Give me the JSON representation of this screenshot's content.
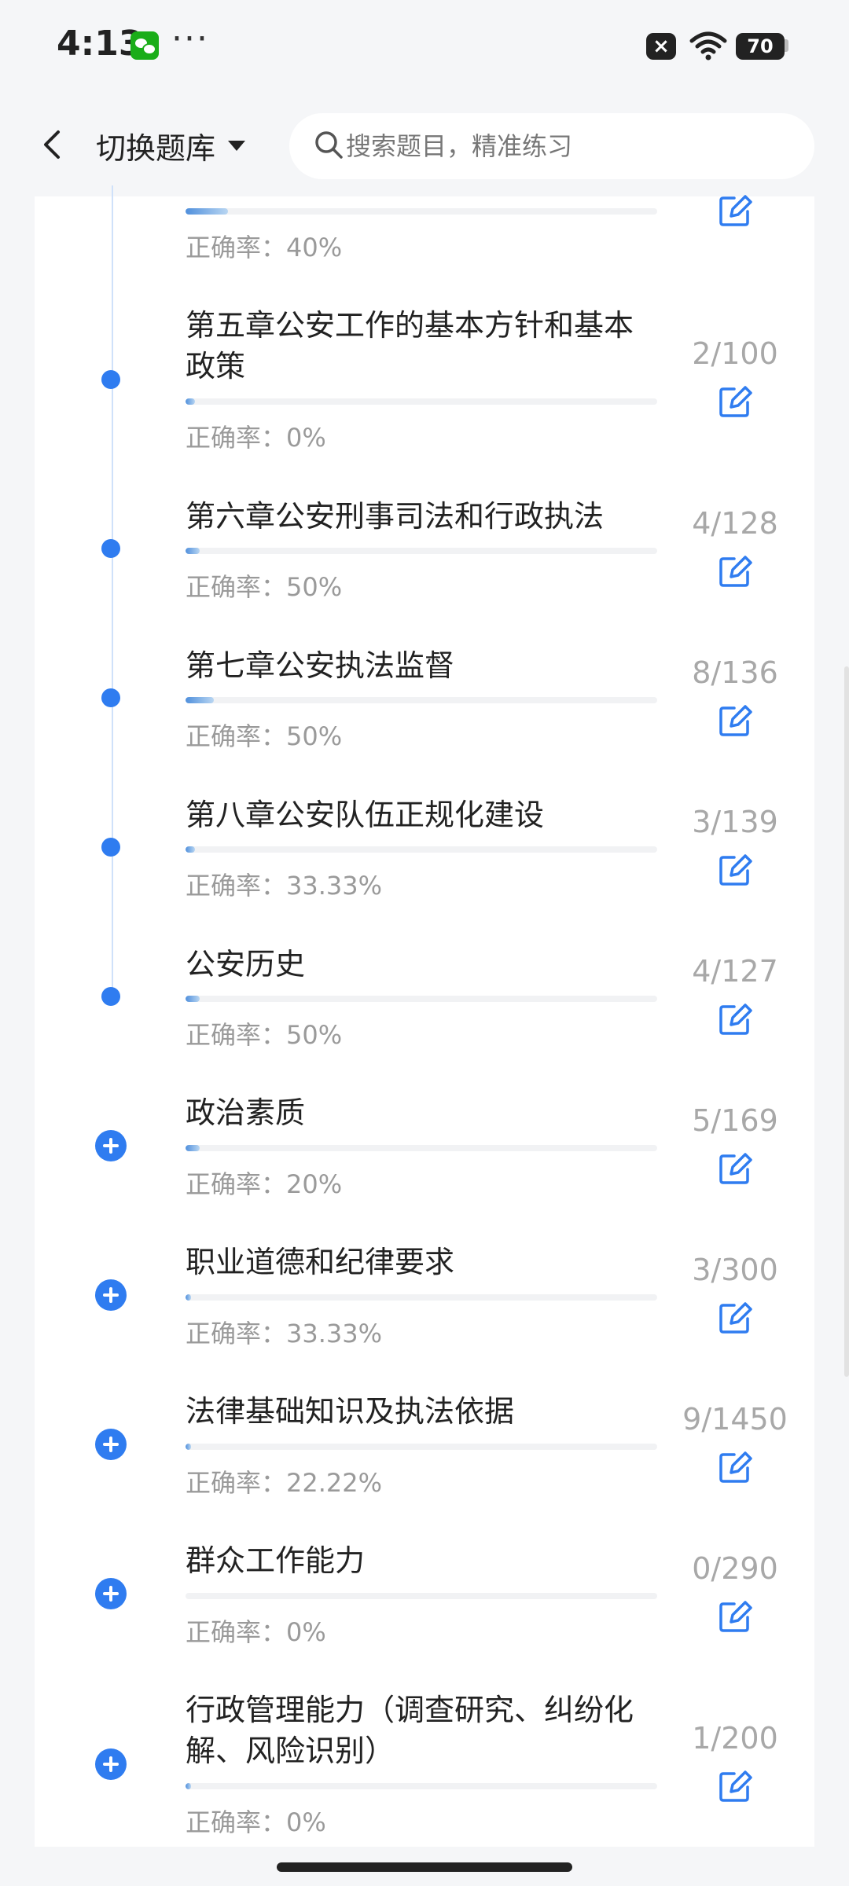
{
  "status_bar": {
    "time": "4:13",
    "more": "···",
    "notification_icon": "close-box-icon",
    "battery": "70"
  },
  "nav": {
    "switch_label": "切换题库",
    "search_placeholder": "搜索题目，精准练习"
  },
  "colors": {
    "accent": "#2f7cf0",
    "muted": "#a8a8a8"
  },
  "chapters": [
    {
      "title": "",
      "count": "",
      "progress": 0.09,
      "accuracy": "正确率：40%",
      "marker": "dot"
    },
    {
      "title": "第五章公安工作的基本方针和基本政策",
      "count": "2/100",
      "progress": 0.02,
      "accuracy": "正确率：0%",
      "marker": "dot"
    },
    {
      "title": "第六章公安刑事司法和行政执法",
      "count": "4/128",
      "progress": 0.03,
      "accuracy": "正确率：50%",
      "marker": "dot"
    },
    {
      "title": "第七章公安执法监督",
      "count": "8/136",
      "progress": 0.06,
      "accuracy": "正确率：50%",
      "marker": "dot"
    },
    {
      "title": "第八章公安队伍正规化建设",
      "count": "3/139",
      "progress": 0.02,
      "accuracy": "正确率：33.33%",
      "marker": "dot"
    },
    {
      "title": "公安历史",
      "count": "4/127",
      "progress": 0.03,
      "accuracy": "正确率：50%",
      "marker": "dot"
    },
    {
      "title": "政治素质",
      "count": "5/169",
      "progress": 0.03,
      "accuracy": "正确率：20%",
      "marker": "plus"
    },
    {
      "title": "职业道德和纪律要求",
      "count": "3/300",
      "progress": 0.01,
      "accuracy": "正确率：33.33%",
      "marker": "plus"
    },
    {
      "title": "法律基础知识及执法依据",
      "count": "9/1450",
      "progress": 0.006,
      "accuracy": "正确率：22.22%",
      "marker": "plus"
    },
    {
      "title": "群众工作能力",
      "count": "0/290",
      "progress": 0,
      "accuracy": "正确率：0%",
      "marker": "plus"
    },
    {
      "title": "行政管理能力（调查研究、纠纷化解、风险识别）",
      "count": "1/200",
      "progress": 0.005,
      "accuracy": "正确率：0%",
      "marker": "plus"
    }
  ]
}
